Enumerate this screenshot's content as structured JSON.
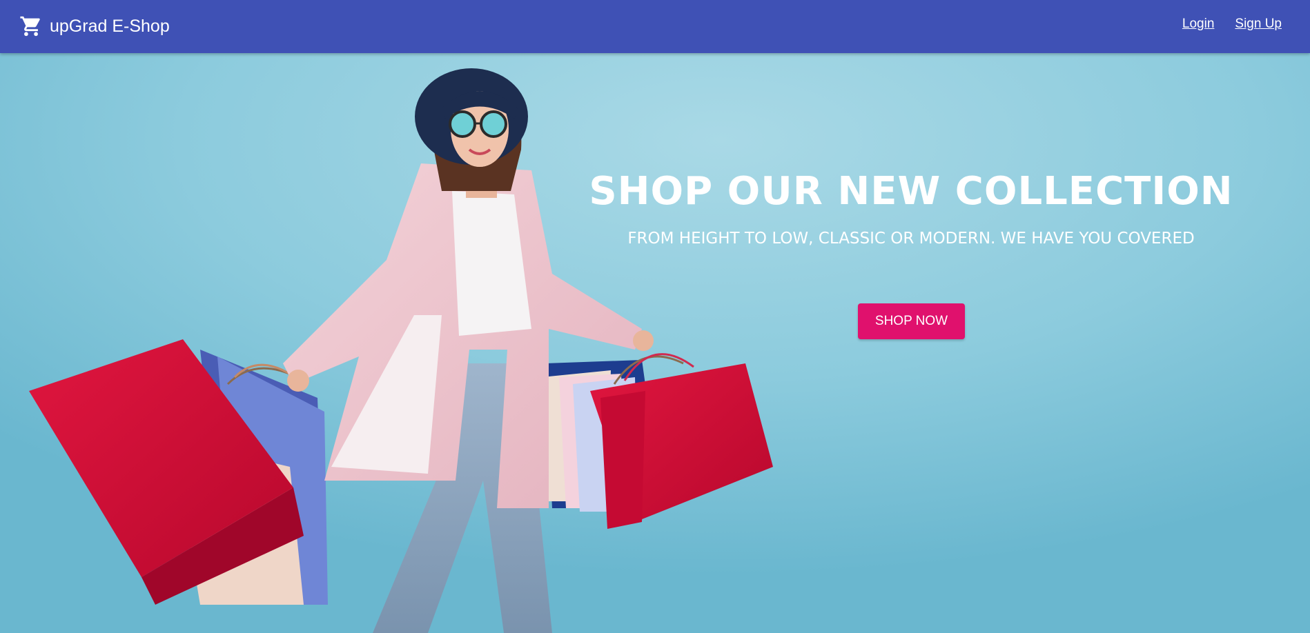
{
  "appbar": {
    "brand_icon": "shopping-cart-icon",
    "title": "upGrad E-Shop",
    "links": [
      {
        "label": "Login"
      },
      {
        "label": "Sign Up"
      }
    ],
    "color": "#3f51b5"
  },
  "hero": {
    "title": "SHOP OUR NEW COLLECTION",
    "subtitle": "FROM HEIGHT TO LOW, CLASSIC OR MODERN. WE HAVE YOU COVERED",
    "cta_label": "SHOP NOW",
    "cta_color": "#e0116d",
    "background_color": "#8ccbdd"
  }
}
